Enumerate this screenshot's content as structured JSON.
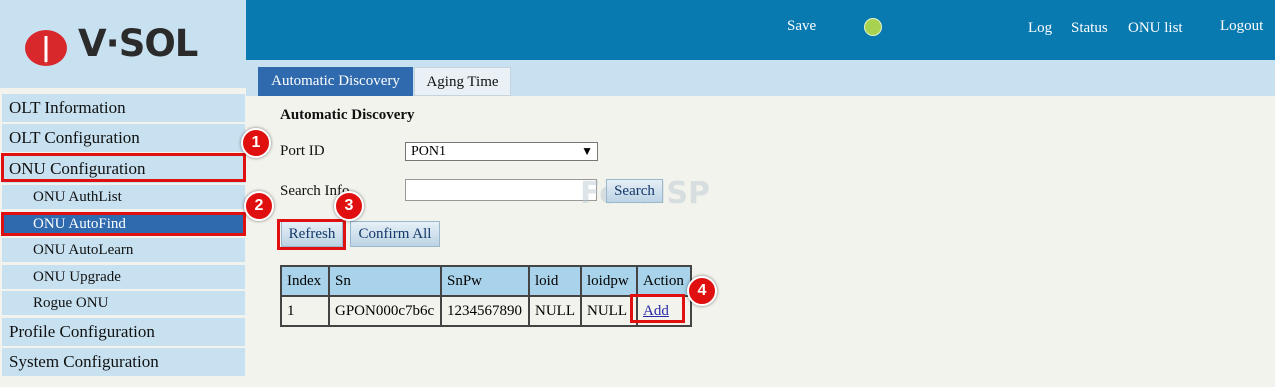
{
  "brand": {
    "name": "V·SOL"
  },
  "header": {
    "save": "Save",
    "log": "Log",
    "status": "Status",
    "onu_list": "ONU list",
    "logout": "Logout",
    "status_dot_color": "#a7d350"
  },
  "sidebar": {
    "olt_information": "OLT Information",
    "olt_configuration": "OLT Configuration",
    "onu_configuration": "ONU Configuration",
    "onu_sub": [
      "ONU AuthList",
      "ONU AutoFind",
      "ONU AutoLearn",
      "ONU Upgrade",
      "Rogue ONU"
    ],
    "profile_configuration": "Profile Configuration",
    "system_configuration": "System Configuration"
  },
  "tabs": {
    "automatic_discovery": "Automatic Discovery",
    "aging_time": "Aging Time"
  },
  "main": {
    "title": "Automatic Discovery",
    "port_id_label": "Port ID",
    "port_id_value": "PON1",
    "search_label": "Search Info",
    "search_value": "",
    "search_button": "Search",
    "refresh_button": "Refresh",
    "confirm_all_button": "Confirm All",
    "watermark": "ForoISP"
  },
  "table": {
    "headers": [
      "Index",
      "Sn",
      "SnPw",
      "loid",
      "loidpw",
      "Action"
    ],
    "rows": [
      [
        "1",
        "GPON000c7b6c",
        "1234567890",
        "NULL",
        "NULL",
        "Add"
      ]
    ]
  },
  "annotations": {
    "step1": "1",
    "step2": "2",
    "step3": "3",
    "step4": "4",
    "color": "#e01010"
  }
}
